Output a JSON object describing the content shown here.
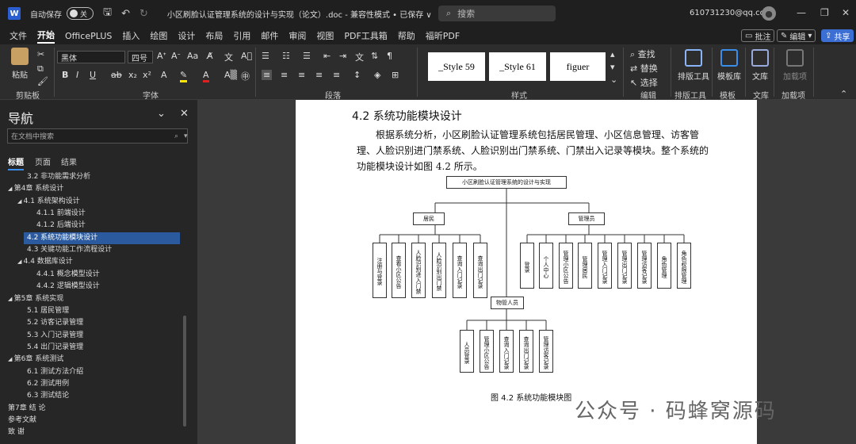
{
  "titlebar": {
    "app_icon": "W",
    "autosave_label": "自动保存",
    "autosave_state": "关",
    "doc_title": "小区刷脸认证管理系统的设计与实现（论文）.doc - 兼容性模式 • 已保存 ∨",
    "search_placeholder": "搜索",
    "account": "610731230@qq.com"
  },
  "menu": {
    "items": [
      "文件",
      "开始",
      "OfficePLUS",
      "插入",
      "绘图",
      "设计",
      "布局",
      "引用",
      "邮件",
      "审阅",
      "视图",
      "PDF工具箱",
      "帮助",
      "福昕PDF"
    ],
    "comment_btn": "批注",
    "edit_btn": "编辑",
    "share_btn": "共享"
  },
  "ribbon": {
    "paste": "粘贴",
    "font_name": "黑体",
    "font_size": "四号",
    "style1": "_Style 59",
    "style2": "_Style 61",
    "style3": "figuer",
    "find": "查找",
    "replace": "替换",
    "select": "选择",
    "layout_tool": "排版工具",
    "template_lib": "模板库",
    "doc_lib": "文库",
    "addin": "加载项",
    "groups": [
      "剪贴板",
      "字体",
      "段落",
      "样式",
      "编辑",
      "排版工具",
      "模板",
      "文库",
      "加载项"
    ]
  },
  "nav": {
    "title": "导航",
    "search_placeholder": "在文档中搜索",
    "tabs": [
      "标题",
      "页面",
      "结果"
    ],
    "items": [
      {
        "text": "3.2 非功能需求分析",
        "level": 2,
        "arrow": ""
      },
      {
        "text": "第4章 系统设计",
        "level": 0,
        "arrow": "◢"
      },
      {
        "text": "4.1 系统架构设计",
        "level": 1,
        "arrow": "◢"
      },
      {
        "text": "4.1.1 前端设计",
        "level": 3,
        "arrow": ""
      },
      {
        "text": "4.1.2 后端设计",
        "level": 3,
        "arrow": ""
      },
      {
        "text": "4.2 系统功能模块设计",
        "level": 2,
        "arrow": "",
        "selected": true
      },
      {
        "text": "4.3 关键功能工作流程设计",
        "level": 2,
        "arrow": ""
      },
      {
        "text": "4.4 数据库设计",
        "level": 1,
        "arrow": "◢"
      },
      {
        "text": "4.4.1 概念模型设计",
        "level": 3,
        "arrow": ""
      },
      {
        "text": "4.4.2 逻辑模型设计",
        "level": 3,
        "arrow": ""
      },
      {
        "text": "第5章 系统实现",
        "level": 0,
        "arrow": "◢"
      },
      {
        "text": "5.1 居民管理",
        "level": 2,
        "arrow": ""
      },
      {
        "text": "5.2 访客记录管理",
        "level": 2,
        "arrow": ""
      },
      {
        "text": "5.3 入门记录管理",
        "level": 2,
        "arrow": ""
      },
      {
        "text": "5.4 出门记录管理",
        "level": 2,
        "arrow": ""
      },
      {
        "text": "第6章 系统测试",
        "level": 0,
        "arrow": "◢"
      },
      {
        "text": "6.1 测试方法介绍",
        "level": 2,
        "arrow": ""
      },
      {
        "text": "6.2 测试用例",
        "level": 2,
        "arrow": ""
      },
      {
        "text": "6.3 测试结论",
        "level": 2,
        "arrow": ""
      },
      {
        "text": "第7章 结  论",
        "level": 0,
        "arrow": ""
      },
      {
        "text": "参考文献",
        "level": 0,
        "arrow": ""
      },
      {
        "text": "致  谢",
        "level": 0,
        "arrow": ""
      }
    ]
  },
  "doc": {
    "heading": "4.2   系统功能模块设计",
    "para1": "根据系统分析，小区刷脸认证管理系统包括居民管理、小区信息管理、访客管",
    "para2": "理、人脸识别进门禁系统、人脸识别出门禁系统、门禁出入记录等模块。整个系统的",
    "para3": "功能模块设计如图 4.2 所示。",
    "caption": "图 4.2  系统功能模块图"
  },
  "diagram": {
    "root": "小区刷脸认证管理系统的设计与实现",
    "resident": "居民",
    "admin": "管理员",
    "property": "物管人员",
    "resident_children": [
      "注册与登录",
      "查看小区公告",
      "人脸识别进入门禁",
      "人脸识别出门禁",
      "查询入门记录",
      "查询出门记录"
    ],
    "admin_children": [
      "登录",
      "个人中心",
      "管理小区公告",
      "管理居民",
      "管理入门记录",
      "管理出门记录",
      "管理访客记录",
      "角色管理",
      "角色权限管理"
    ],
    "property_children": [
      "人员登录",
      "管理小区公告",
      "查询入门记录",
      "查询出门记录",
      "管理访客记录"
    ]
  },
  "watermark": "公众号 · 码蜂窝源码"
}
